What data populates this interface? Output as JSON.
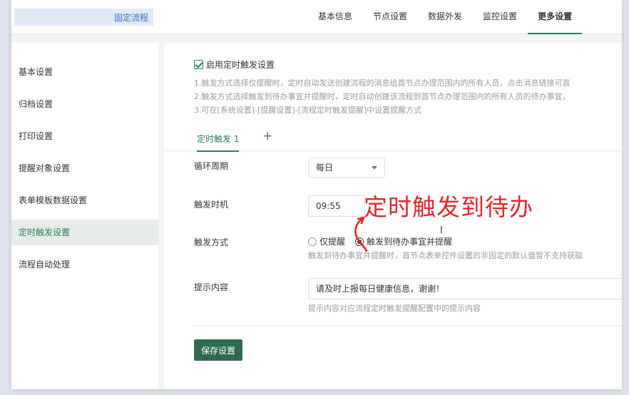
{
  "header": {
    "title": "固定流程",
    "tabs": [
      {
        "label": "基本信息"
      },
      {
        "label": "节点设置"
      },
      {
        "label": "数据外发"
      },
      {
        "label": "监控设置"
      },
      {
        "label": "更多设置"
      }
    ],
    "active_tab": "更多设置"
  },
  "sidebar": {
    "items": [
      {
        "label": "基本设置"
      },
      {
        "label": "归档设置"
      },
      {
        "label": "打印设置"
      },
      {
        "label": "提醒对象设置"
      },
      {
        "label": "表单模板数据设置"
      },
      {
        "label": "定时触发设置"
      },
      {
        "label": "流程自动处理"
      }
    ],
    "active_item": "定时触发设置"
  },
  "main": {
    "enable_label": "启用定时触发设置",
    "enable_checked": true,
    "notes": [
      "1.触发方式选择仅提醒时，定时自动发送创建流程的消息给首节点办理范围内的所有人员，点击消息链接可直",
      "2.触发方式选择触发到待办事宜并提醒时，定时自动创建该流程到首节点办理范围内的所有人员的待办事宜，",
      "3.可在[系统设置]-[提醒设置]-[流程定时触发提醒]中设置提醒方式"
    ],
    "subtab_label": "定时触发 1",
    "add_tab_symbol": "+",
    "cycle_label": "循环周期",
    "cycle_value": "每日",
    "time_label": "触发时机",
    "time_value": "09:55",
    "mode_label": "触发方式",
    "mode_options": [
      "仅提醒",
      "触发到待办事宜并提醒"
    ],
    "mode_selected": "触发到待办事宜并提醒",
    "mode_hint": "触发到待办事宜并提醒时，首节点表单控件设置的非固定的默认值暂不支持获取",
    "content_label": "提示内容",
    "content_value": "请及时上报每日健康信息，谢谢！",
    "content_hint": "提示内容对应流程定时触发提醒配置中的提示内容",
    "save_label": "保存设置"
  },
  "annotation": {
    "text": "定时触发到待办",
    "color": "#e02a2a"
  },
  "colors": {
    "accent": "#2e7d5b",
    "button": "#2e6b52"
  }
}
